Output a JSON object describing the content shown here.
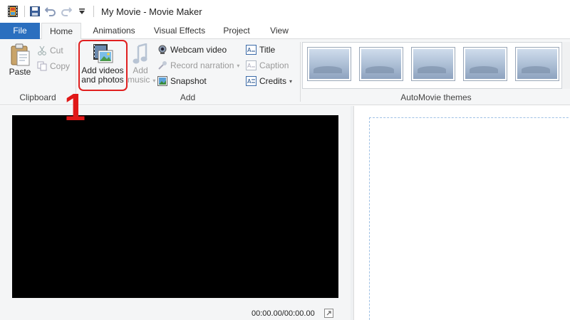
{
  "window": {
    "title": "My Movie - Movie Maker"
  },
  "quick_access": [
    {
      "icon": "movie-maker-app-icon"
    },
    {
      "icon": "save-icon"
    },
    {
      "icon": "undo-icon"
    },
    {
      "icon": "redo-icon"
    },
    {
      "icon": "customize-dropdown-icon"
    }
  ],
  "tabs": {
    "file": "File",
    "home": "Home",
    "animations": "Animations",
    "visual_effects": "Visual Effects",
    "project": "Project",
    "view": "View"
  },
  "ribbon": {
    "clipboard": {
      "label": "Clipboard",
      "paste": "Paste",
      "cut": "Cut",
      "copy": "Copy"
    },
    "add": {
      "label": "Add",
      "add_videos_line1": "Add videos",
      "add_videos_line2": "and photos",
      "add_music_line1": "Add",
      "add_music_line2": "music",
      "webcam_video": "Webcam video",
      "record_narration": "Record narration",
      "snapshot": "Snapshot",
      "title": "Title",
      "caption": "Caption",
      "credits": "Credits"
    },
    "automovie": {
      "label": "AutoMovie themes"
    }
  },
  "preview": {
    "timecode": "00:00.00/00:00.00"
  },
  "annotation": {
    "step": "1"
  },
  "colors": {
    "file_tab": "#2b6fbf",
    "highlight": "#e02020",
    "step_number": "#e01818"
  }
}
